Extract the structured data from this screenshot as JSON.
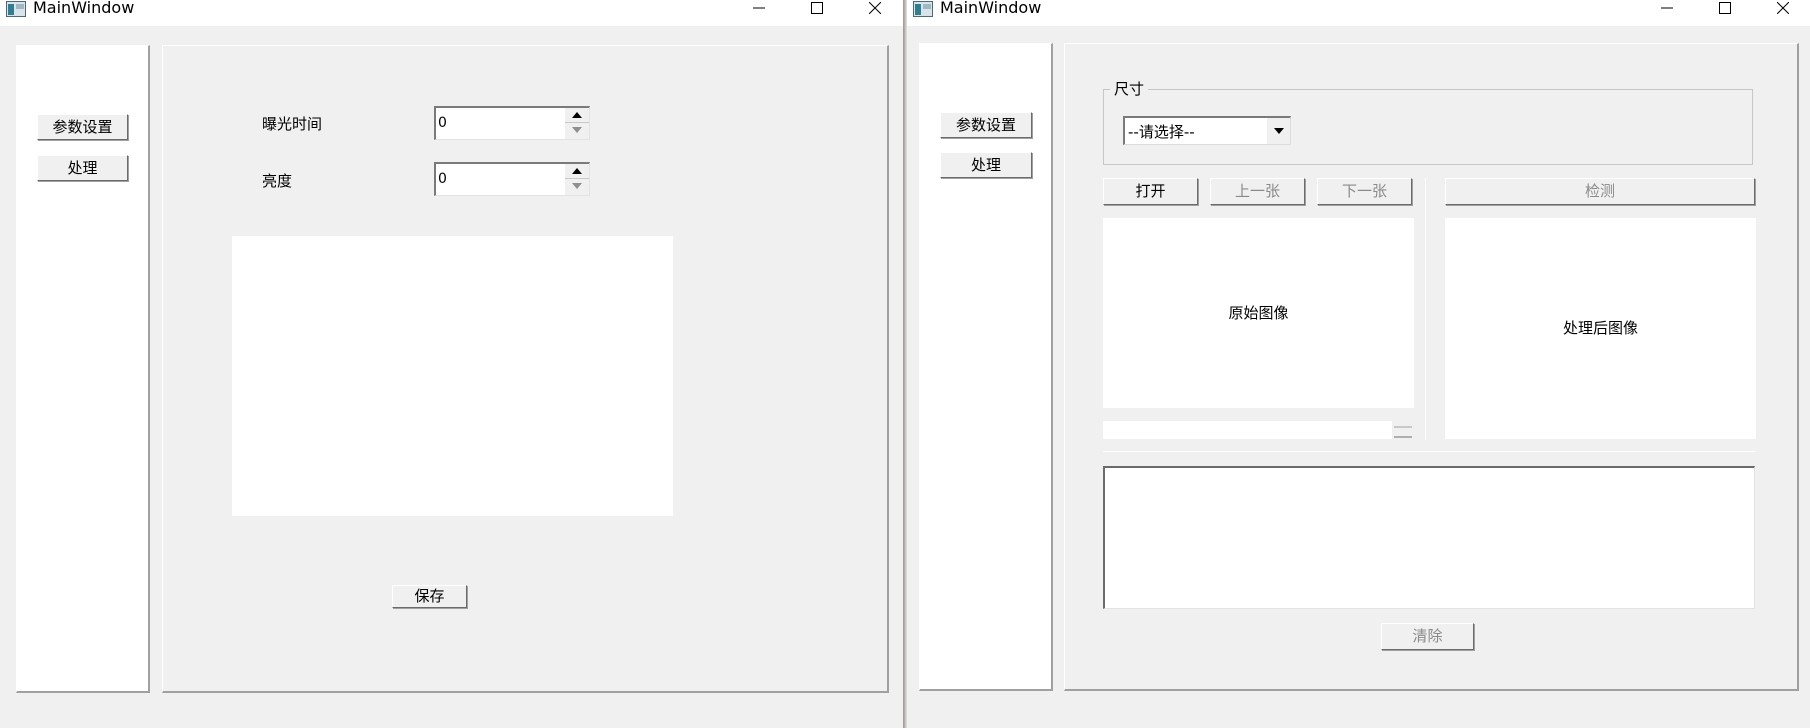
{
  "window_left": {
    "title": "MainWindow",
    "sidebar": {
      "param_button": "参数设置",
      "process_button": "处理"
    },
    "content": {
      "exposure_label": "曝光时间",
      "exposure_value": "0",
      "brightness_label": "亮度",
      "brightness_value": "0",
      "save_button": "保存"
    }
  },
  "window_right": {
    "title": "MainWindow",
    "sidebar": {
      "param_button": "参数设置",
      "process_button": "处理"
    },
    "content": {
      "size_group_title": "尺寸",
      "size_select_value": "--请选择--",
      "open_button": "打开",
      "prev_button": "上一张",
      "next_button": "下一张",
      "detect_button": "检测",
      "original_image_label": "原始图像",
      "processed_image_label": "处理后图像",
      "clear_button": "清除"
    }
  },
  "icons": {
    "app": "window-app-icon",
    "minimize": "minimize-icon",
    "maximize": "maximize-icon",
    "close": "close-icon",
    "spin_up": "spin-up-arrow-icon",
    "spin_down": "spin-down-arrow-icon",
    "dropdown": "dropdown-arrow-icon"
  },
  "colors": {
    "window_bg": "#f0f0f0",
    "titlebar_bg": "#ffffff",
    "disabled_text": "#8a8a8a"
  }
}
